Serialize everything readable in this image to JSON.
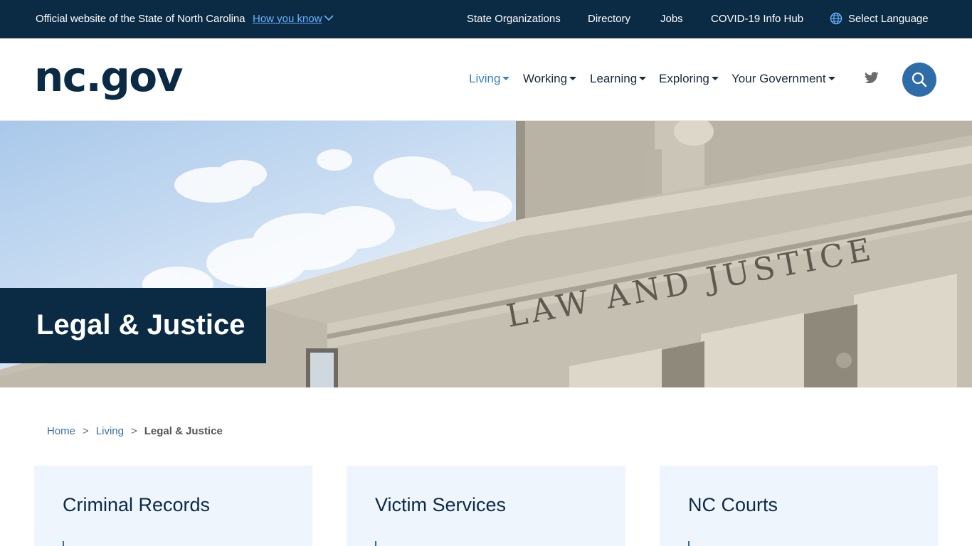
{
  "topbar": {
    "official_text": "Official website of the State of North Carolina",
    "how_you_know": "How you know",
    "links": [
      "State Organizations",
      "Directory",
      "Jobs",
      "COVID-19 Info Hub"
    ],
    "language": "Select Language",
    "background_color": "#0b2a44"
  },
  "header": {
    "logo": "nc.gov",
    "nav": [
      {
        "label": "Living",
        "active": true
      },
      {
        "label": "Working",
        "active": false
      },
      {
        "label": "Learning",
        "active": false
      },
      {
        "label": "Exploring",
        "active": false
      },
      {
        "label": "Your Government",
        "active": false
      }
    ],
    "social_icon": "twitter-icon",
    "search_icon": "search-icon",
    "accent_color": "#2f6da8"
  },
  "hero": {
    "title": "Legal & Justice",
    "engraving": "LAW AND JUSTICE"
  },
  "breadcrumb": {
    "home": "Home",
    "separator": ">",
    "parent": "Living",
    "current": "Legal & Justice"
  },
  "cards": [
    {
      "title": "Criminal Records"
    },
    {
      "title": "Victim Services"
    },
    {
      "title": "NC Courts"
    }
  ]
}
